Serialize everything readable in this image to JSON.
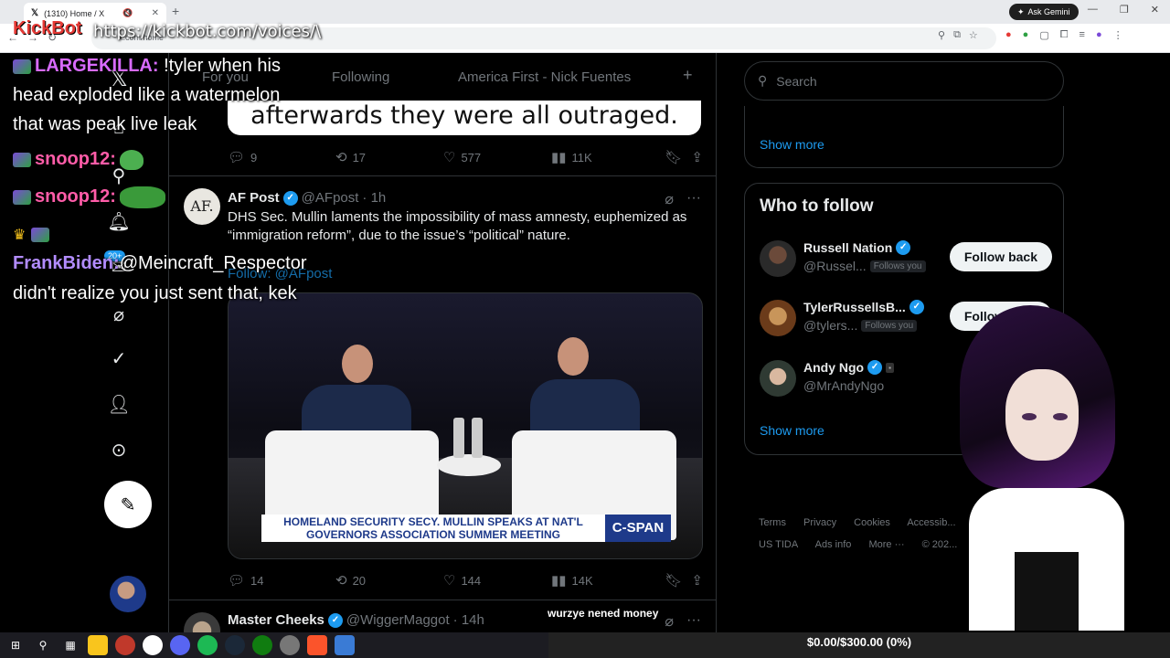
{
  "browser": {
    "tab_title": "(1310) Home / X",
    "url": "x.com/home",
    "ask_gemini_label": "Ask Gemini",
    "window_controls": [
      "—",
      "❐",
      "✕"
    ]
  },
  "overlay": {
    "kickbot_label": "KickBot",
    "kickbot_url": "https://kickbot.com/voices/\\",
    "chat": [
      {
        "user": "LARGEKILLA:",
        "user_color": "#d86bff",
        "text": "!tyler when his"
      },
      {
        "user": "",
        "user_color": "#ffffff",
        "text": "head exploded like a watermelon"
      },
      {
        "user": "",
        "user_color": "#ffffff",
        "text": "that was peak live leak"
      },
      {
        "user": "snoop12:",
        "user_color": "#ff5ca8",
        "text": ""
      },
      {
        "user": "snoop12:",
        "user_color": "#ff5ca8",
        "text": ""
      },
      {
        "user": "FrankBiden:",
        "user_color": "#b28cff",
        "text": "@Meincraft_Respector"
      },
      {
        "user": "",
        "user_color": "#ffffff",
        "text": "didn't realize you just sent that, kek"
      }
    ],
    "donation_text": "$0.00/$300.00 (0%)",
    "tts_text": "wurzye nened money",
    "notif_badge": "20+"
  },
  "timeline": {
    "tabs": [
      "For you",
      "Following",
      "America First - Nick Fuentes"
    ],
    "prev_caption": "afterwards they were all outraged.",
    "prev_actions": {
      "replies": "9",
      "reposts": "17",
      "likes": "577",
      "views": "11K"
    },
    "post": {
      "avatar_text": "AF.",
      "name": "AF Post",
      "handle": "@AFpost",
      "time": "· 1h",
      "text": "DHS Sec. Mullin laments the impossibility of mass amnesty, euphemized as “immigration reform”, due to the issue’s “political” nature.",
      "follow_line": "Follow: @AFpost",
      "video_lower_third": "HOMELAND SECURITY SECY. MULLIN SPEAKS AT NAT'L GOVERNORS ASSOCIATION SUMMER MEETING",
      "video_brand": "C-SPAN",
      "actions": {
        "replies": "14",
        "reposts": "20",
        "likes": "144",
        "views": "14K"
      }
    },
    "next_post": {
      "name": "Master Cheeks",
      "handle": "@WiggerMaggot",
      "time": "· 14h"
    }
  },
  "right_sidebar": {
    "search_placeholder": "Search",
    "show_more_1": "Show more",
    "who_to_follow_title": "Who to follow",
    "suggestions": [
      {
        "name": "Russell Nation",
        "handle": "@Russel...",
        "follows_you": "Follows you",
        "button": "Follow back"
      },
      {
        "name": "TylerRussellsB...",
        "handle": "@tylers...",
        "follows_you": "Follows you",
        "button": "Follow back"
      },
      {
        "name": "Andy Ngo",
        "handle": "@MrAndyNgo",
        "follows_you": "",
        "button": ""
      }
    ],
    "show_more_2": "Show more",
    "footer": [
      "Terms",
      "Privacy",
      "Cookies",
      "Accessib...",
      "US TIDA",
      "Ads info",
      "More ···",
      "© 202..."
    ]
  },
  "colors": {
    "accent": "#1d9bf0",
    "background": "#000000",
    "kickbot_red": "#e53935"
  }
}
